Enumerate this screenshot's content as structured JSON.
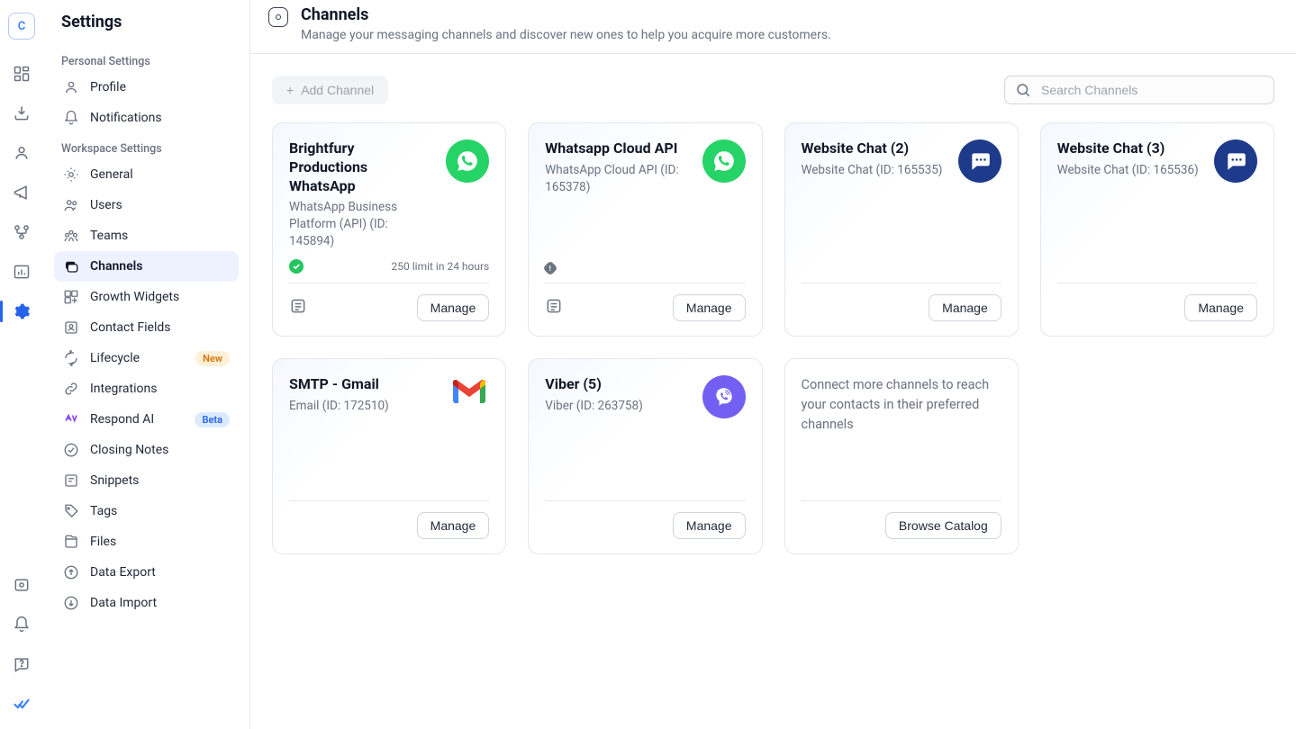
{
  "rail": {
    "avatar_letter": "C"
  },
  "sidebar": {
    "title": "Settings",
    "section_personal": "Personal Settings",
    "section_workspace": "Workspace Settings",
    "items": {
      "profile": "Profile",
      "notifications": "Notifications",
      "general": "General",
      "users": "Users",
      "teams": "Teams",
      "channels": "Channels",
      "growth_widgets": "Growth Widgets",
      "contact_fields": "Contact Fields",
      "lifecycle": "Lifecycle",
      "integrations": "Integrations",
      "respond_ai": "Respond AI",
      "closing_notes": "Closing Notes",
      "snippets": "Snippets",
      "tags": "Tags",
      "files": "Files",
      "data_export": "Data Export",
      "data_import": "Data Import"
    },
    "badges": {
      "new": "New",
      "beta": "Beta"
    }
  },
  "header": {
    "title": "Channels",
    "description": "Manage your messaging channels and discover new ones to help you acquire more customers."
  },
  "toolbar": {
    "add_channel": "Add Channel",
    "search_placeholder": "Search Channels"
  },
  "channels": [
    {
      "title": "Brightfury Productions WhatsApp",
      "subtitle": "WhatsApp Business Platform (API) (ID: 145894)",
      "icon": "whatsapp",
      "status": "ok",
      "limit": "250 limit in 24 hours",
      "has_feed_icon": true,
      "manage": "Manage"
    },
    {
      "title": "Whatsapp Cloud API",
      "subtitle": "WhatsApp Cloud API (ID: 165378)",
      "icon": "whatsapp",
      "status": "warn",
      "limit": "",
      "has_feed_icon": true,
      "manage": "Manage"
    },
    {
      "title": "Website Chat (2)",
      "subtitle": "Website Chat (ID: 165535)",
      "icon": "chat",
      "status": null,
      "limit": "",
      "has_feed_icon": false,
      "manage": "Manage"
    },
    {
      "title": "Website Chat (3)",
      "subtitle": "Website Chat (ID: 165536)",
      "icon": "chat",
      "status": null,
      "limit": "",
      "has_feed_icon": false,
      "manage": "Manage"
    },
    {
      "title": "SMTP - Gmail",
      "subtitle": "Email (ID: 172510)",
      "icon": "gmail",
      "status": null,
      "limit": "",
      "has_feed_icon": false,
      "manage": "Manage"
    },
    {
      "title": "Viber (5)",
      "subtitle": "Viber (ID: 263758)",
      "icon": "viber",
      "status": null,
      "limit": "",
      "has_feed_icon": false,
      "manage": "Manage"
    }
  ],
  "catalog": {
    "text": "Connect more channels to reach your contacts in their preferred channels",
    "button": "Browse Catalog"
  }
}
